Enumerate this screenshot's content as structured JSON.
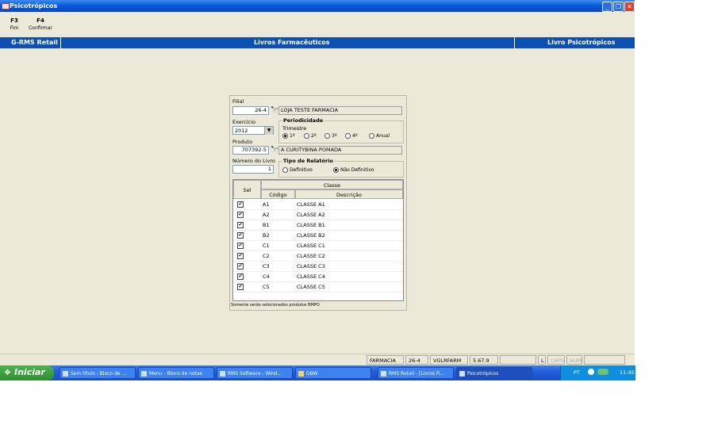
{
  "window": {
    "title": "Psicotrópicos",
    "controls": [
      "_",
      "❐",
      "✕"
    ]
  },
  "toolbar": {
    "f3": {
      "key": "F3",
      "label": "Fim"
    },
    "f4": {
      "key": "F4",
      "label": "Confirmar"
    }
  },
  "header": {
    "left": "G-RMS Retail",
    "center": "Livros Farmacêuticos",
    "right": "Livro Psicotrópicos"
  },
  "form": {
    "filial_label": "Filial",
    "filial_code": "26-4",
    "filial_name": "LOJA TESTE FARMACIA",
    "exercicio_label": "Exercício",
    "exercicio_value": "2012",
    "periodicidade_label": "Periodicidade",
    "trimestre_label": "Trimestre",
    "periods": [
      {
        "label": "1º",
        "selected": true
      },
      {
        "label": "2º",
        "selected": false
      },
      {
        "label": "3º",
        "selected": false
      },
      {
        "label": "4º",
        "selected": false
      },
      {
        "label": "Anual",
        "selected": false
      }
    ],
    "produto_label": "Produto",
    "produto_code": "707392-5",
    "produto_name": "A CURITYBINA POMADA",
    "numero_label": "Número do Livro",
    "numero_value": "1",
    "tipo_label": "Tipo de Relatório",
    "tipo_options": [
      {
        "label": "Definitivo",
        "selected": false
      },
      {
        "label": "Não Definitivo",
        "selected": true
      }
    ]
  },
  "grid": {
    "col_sel": "Sel",
    "col_classe": "Classe",
    "col_codigo": "Código",
    "col_descricao": "Descrição",
    "rows": [
      {
        "checked": true,
        "codigo": "A1",
        "descricao": "CLASSE A1"
      },
      {
        "checked": true,
        "codigo": "A2",
        "descricao": "CLASSE A2"
      },
      {
        "checked": true,
        "codigo": "B1",
        "descricao": "CLASSE B1"
      },
      {
        "checked": true,
        "codigo": "B2",
        "descricao": "CLASSE B2"
      },
      {
        "checked": true,
        "codigo": "C1",
        "descricao": "CLASSE C1"
      },
      {
        "checked": true,
        "codigo": "C2",
        "descricao": "CLASSE C2"
      },
      {
        "checked": true,
        "codigo": "C3",
        "descricao": "CLASSE C3"
      },
      {
        "checked": true,
        "codigo": "C4",
        "descricao": "CLASSE C4"
      },
      {
        "checked": true,
        "codigo": "C5",
        "descricao": "CLASSE C5"
      }
    ]
  },
  "note": "Somente serão selecionados produtos BMPO",
  "statusbar": {
    "store": "FARMACIA",
    "code": "26-4",
    "user": "VGLRFARM",
    "version": "5.67.9",
    "l": "L",
    "caps": "CAPS",
    "num": "NUM"
  },
  "taskbar": {
    "start": "Iniciar",
    "tasks": [
      "Sem título - Bloco de ...",
      "Menu - Bloco de notas",
      "RMS Software - Wind...",
      "DBW",
      "RMS Retail - [Livros Fi...",
      "Psicotrópicos"
    ],
    "lang": "PT",
    "clock": "11:45"
  }
}
